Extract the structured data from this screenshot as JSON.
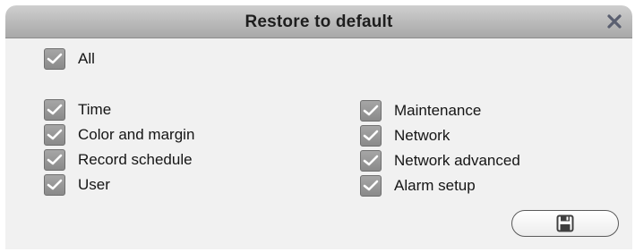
{
  "dialog": {
    "title": "Restore to default",
    "close_icon": "close-icon",
    "all": {
      "label": "All",
      "checked": true
    },
    "left_items": [
      {
        "label": "Time",
        "checked": true
      },
      {
        "label": "Color and margin",
        "checked": true
      },
      {
        "label": "Record schedule",
        "checked": true
      },
      {
        "label": "User",
        "checked": true
      }
    ],
    "right_items": [
      {
        "label": "Maintenance",
        "checked": true
      },
      {
        "label": "Network",
        "checked": true
      },
      {
        "label": "Network advanced",
        "checked": true
      },
      {
        "label": "Alarm setup",
        "checked": true
      }
    ],
    "save_button_icon": "floppy-disk-icon"
  },
  "colors": {
    "title_bar": "#b9b9b9",
    "dialog_bg": "#f1f1f1",
    "checkbox": "#8a8a8a",
    "checkmark": "#ffffff"
  }
}
